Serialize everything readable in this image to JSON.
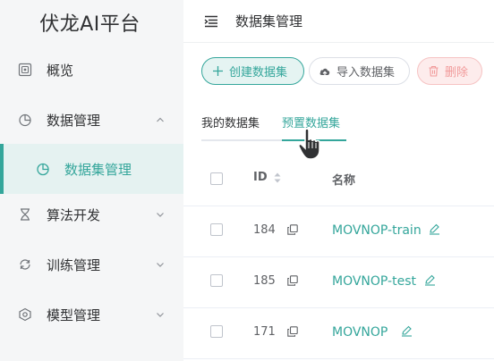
{
  "app": {
    "title": "伏龙AI平台"
  },
  "sidebar": {
    "items": [
      {
        "label": "概览",
        "icon": "dashboard-icon"
      },
      {
        "label": "数据管理",
        "icon": "pie-chart-icon",
        "expanded": true
      },
      {
        "label": "数据集管理",
        "icon": "pie-chart-icon",
        "active": true
      },
      {
        "label": "算法开发",
        "icon": "hourglass-icon"
      },
      {
        "label": "训练管理",
        "icon": "sync-icon"
      },
      {
        "label": "模型管理",
        "icon": "cube-gear-icon"
      }
    ]
  },
  "header": {
    "title": "数据集管理"
  },
  "toolbar": {
    "create_label": "创建数据集",
    "import_label": "导入数据集",
    "delete_label": "删除"
  },
  "tabs": {
    "mine": "我的数据集",
    "preset": "预置数据集",
    "active": "preset"
  },
  "table": {
    "columns": {
      "id": "ID",
      "name": "名称"
    },
    "rows": [
      {
        "id": "184",
        "name": "MOVNOP-train"
      },
      {
        "id": "185",
        "name": "MOVNOP-test"
      },
      {
        "id": "171",
        "name": "MOVNOP"
      }
    ]
  },
  "colors": {
    "accent": "#34a69b",
    "sidebar_bg": "#f5f6f7",
    "danger_text": "#f19a9a"
  }
}
